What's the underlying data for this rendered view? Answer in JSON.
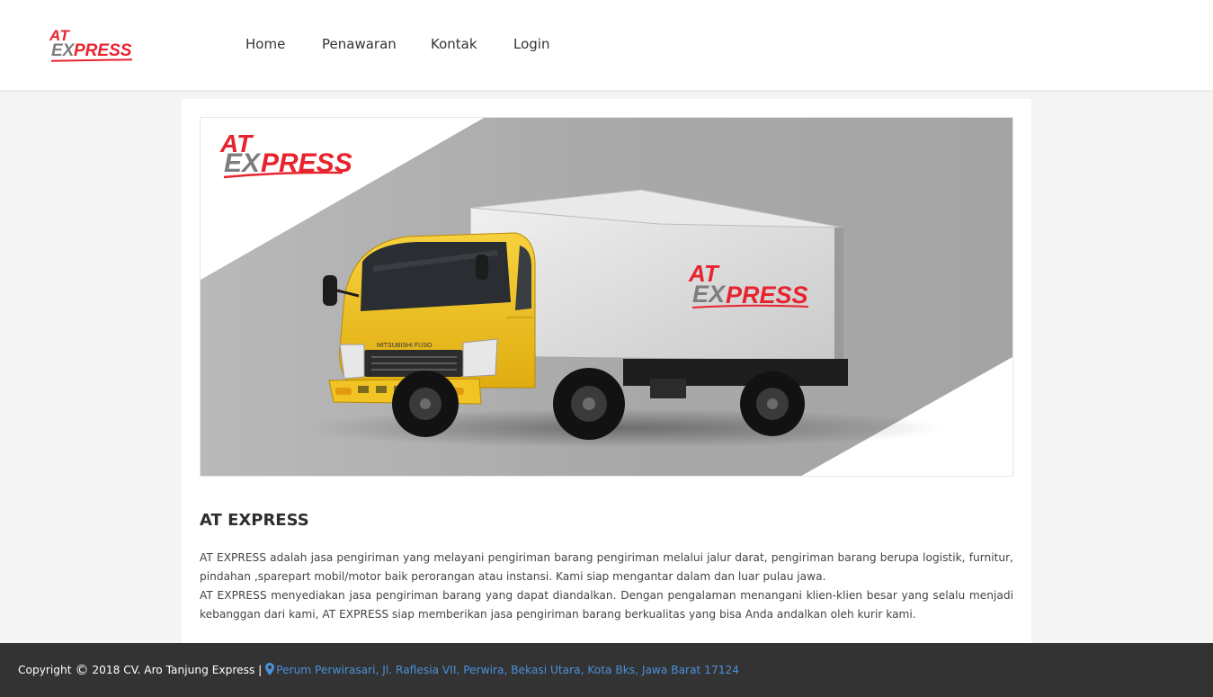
{
  "brand": {
    "at": "AT",
    "ex": "EX",
    "press": "PRESS"
  },
  "nav": {
    "items": [
      {
        "label": "Home"
      },
      {
        "label": "Penawaran"
      },
      {
        "label": "Kontak"
      },
      {
        "label": "Login"
      }
    ]
  },
  "hero": {
    "banner_logo_at": "AT",
    "banner_logo_ex": "EX",
    "banner_logo_press": "PRESS",
    "truck_logo_at": "AT",
    "truck_logo_ex": "EX",
    "truck_logo_press": "PRESS",
    "cab_brand": "MITSUBISHI FUSO"
  },
  "content": {
    "title": "AT EXPRESS",
    "paragraph1": "AT EXPRESS adalah jasa pengiriman yang melayani pengiriman barang pengiriman melalui jalur darat, pengiriman barang berupa logistik, furnitur, pindahan ,sparepart mobil/motor baik perorangan atau instansi. Kami siap mengantar dalam dan luar pulau jawa.",
    "paragraph2": "AT EXPRESS menyediakan jasa pengiriman barang yang dapat diandalkan. Dengan pengalaman menangani klien-klien besar yang selalu menjadi kebanggan dari kami, AT EXPRESS siap memberikan jasa pengiriman barang berkualitas yang bisa Anda andalkan oleh kurir kami."
  },
  "footer": {
    "copyright_prefix": "Copyright",
    "copyright_symbol": "©",
    "copyright_text": "2018 CV. Aro Tanjung Express |",
    "address": "Perum Perwirasari, Jl. Raflesia VII, Perwira, Bekasi Utara, Kota Bks, Jawa Barat 17124"
  },
  "colors": {
    "brand_red": "#e8232e",
    "brand_grey": "#7d7d7d",
    "footer_bg": "#333333",
    "link_blue": "#4a90d9",
    "truck_yellow": "#f2c21b"
  },
  "icons": {
    "copyright": "copyright-icon",
    "address": "map-marker-icon"
  }
}
